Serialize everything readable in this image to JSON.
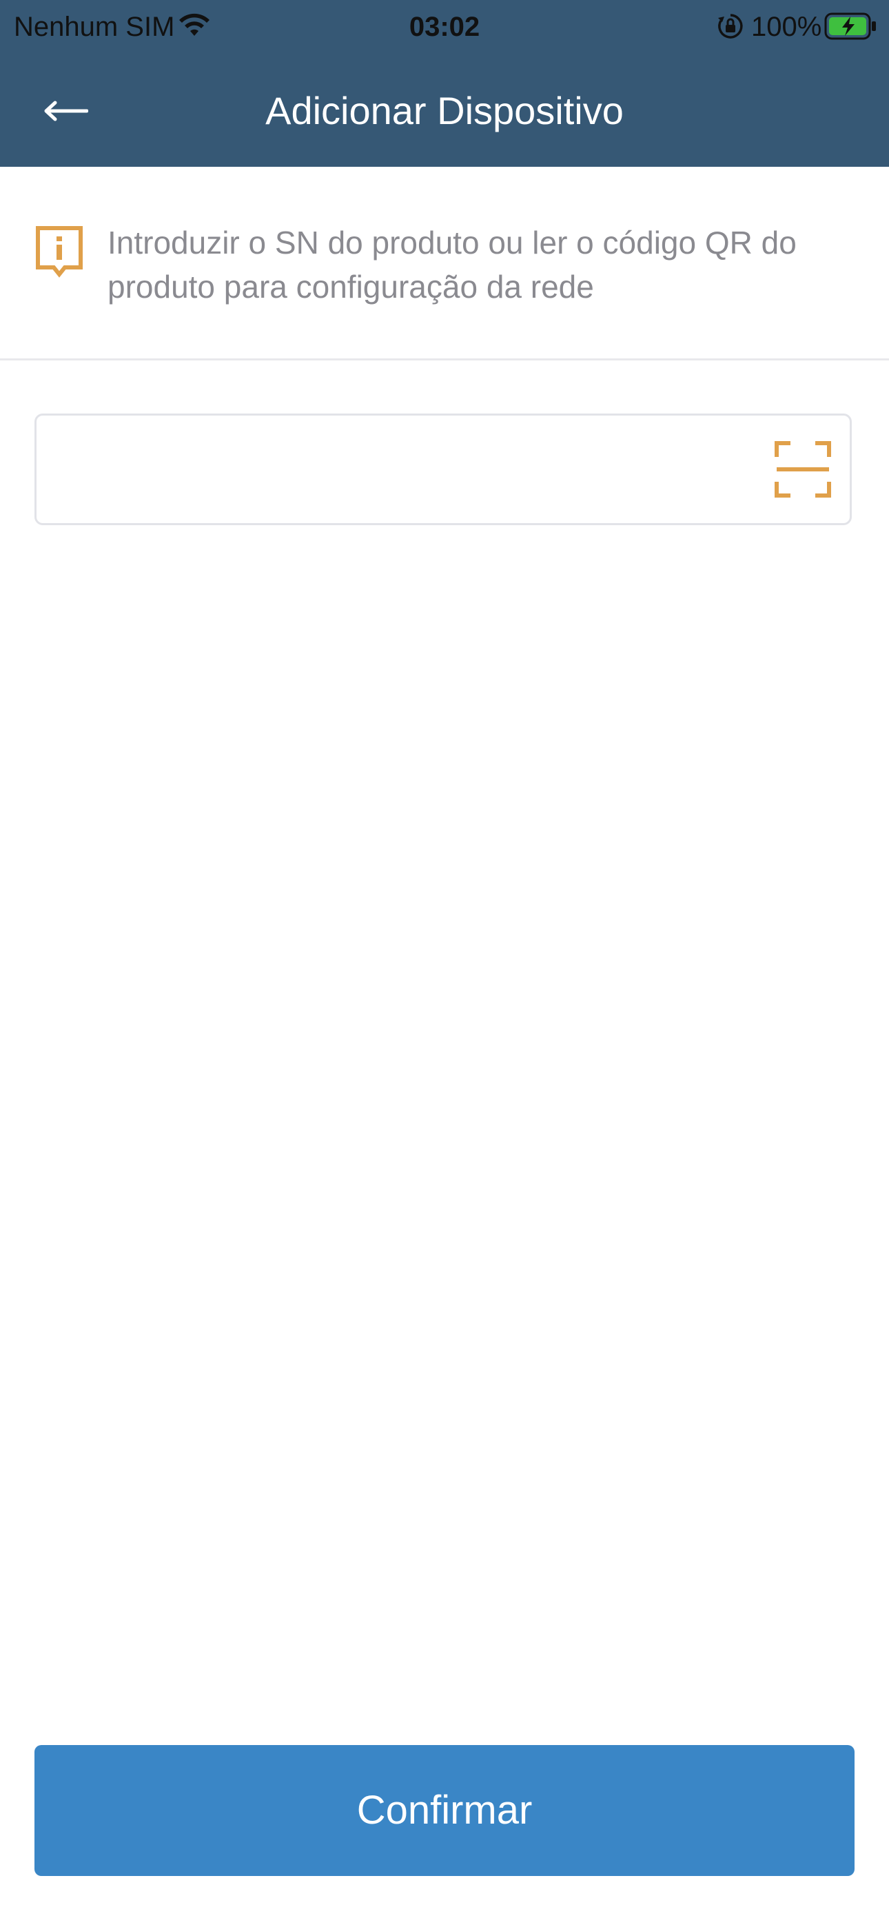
{
  "status_bar": {
    "carrier": "Nenhum SIM",
    "time": "03:02",
    "battery": "100%"
  },
  "nav": {
    "title": "Adicionar Dispositivo",
    "back_icon": "arrow-left-icon"
  },
  "notice": {
    "icon": "info-bubble-icon",
    "text": "Introduzir o SN do produto ou ler o código QR do produto para configuração da rede"
  },
  "sn_field": {
    "value": "",
    "placeholder": "",
    "scan_icon": "qr-scan-icon"
  },
  "actions": {
    "confirm_label": "Confirmar"
  },
  "colors": {
    "header_bg": "#365875",
    "accent_orange": "#e0a04a",
    "primary_button": "#3a86c6",
    "notice_text": "#8a8a90"
  }
}
